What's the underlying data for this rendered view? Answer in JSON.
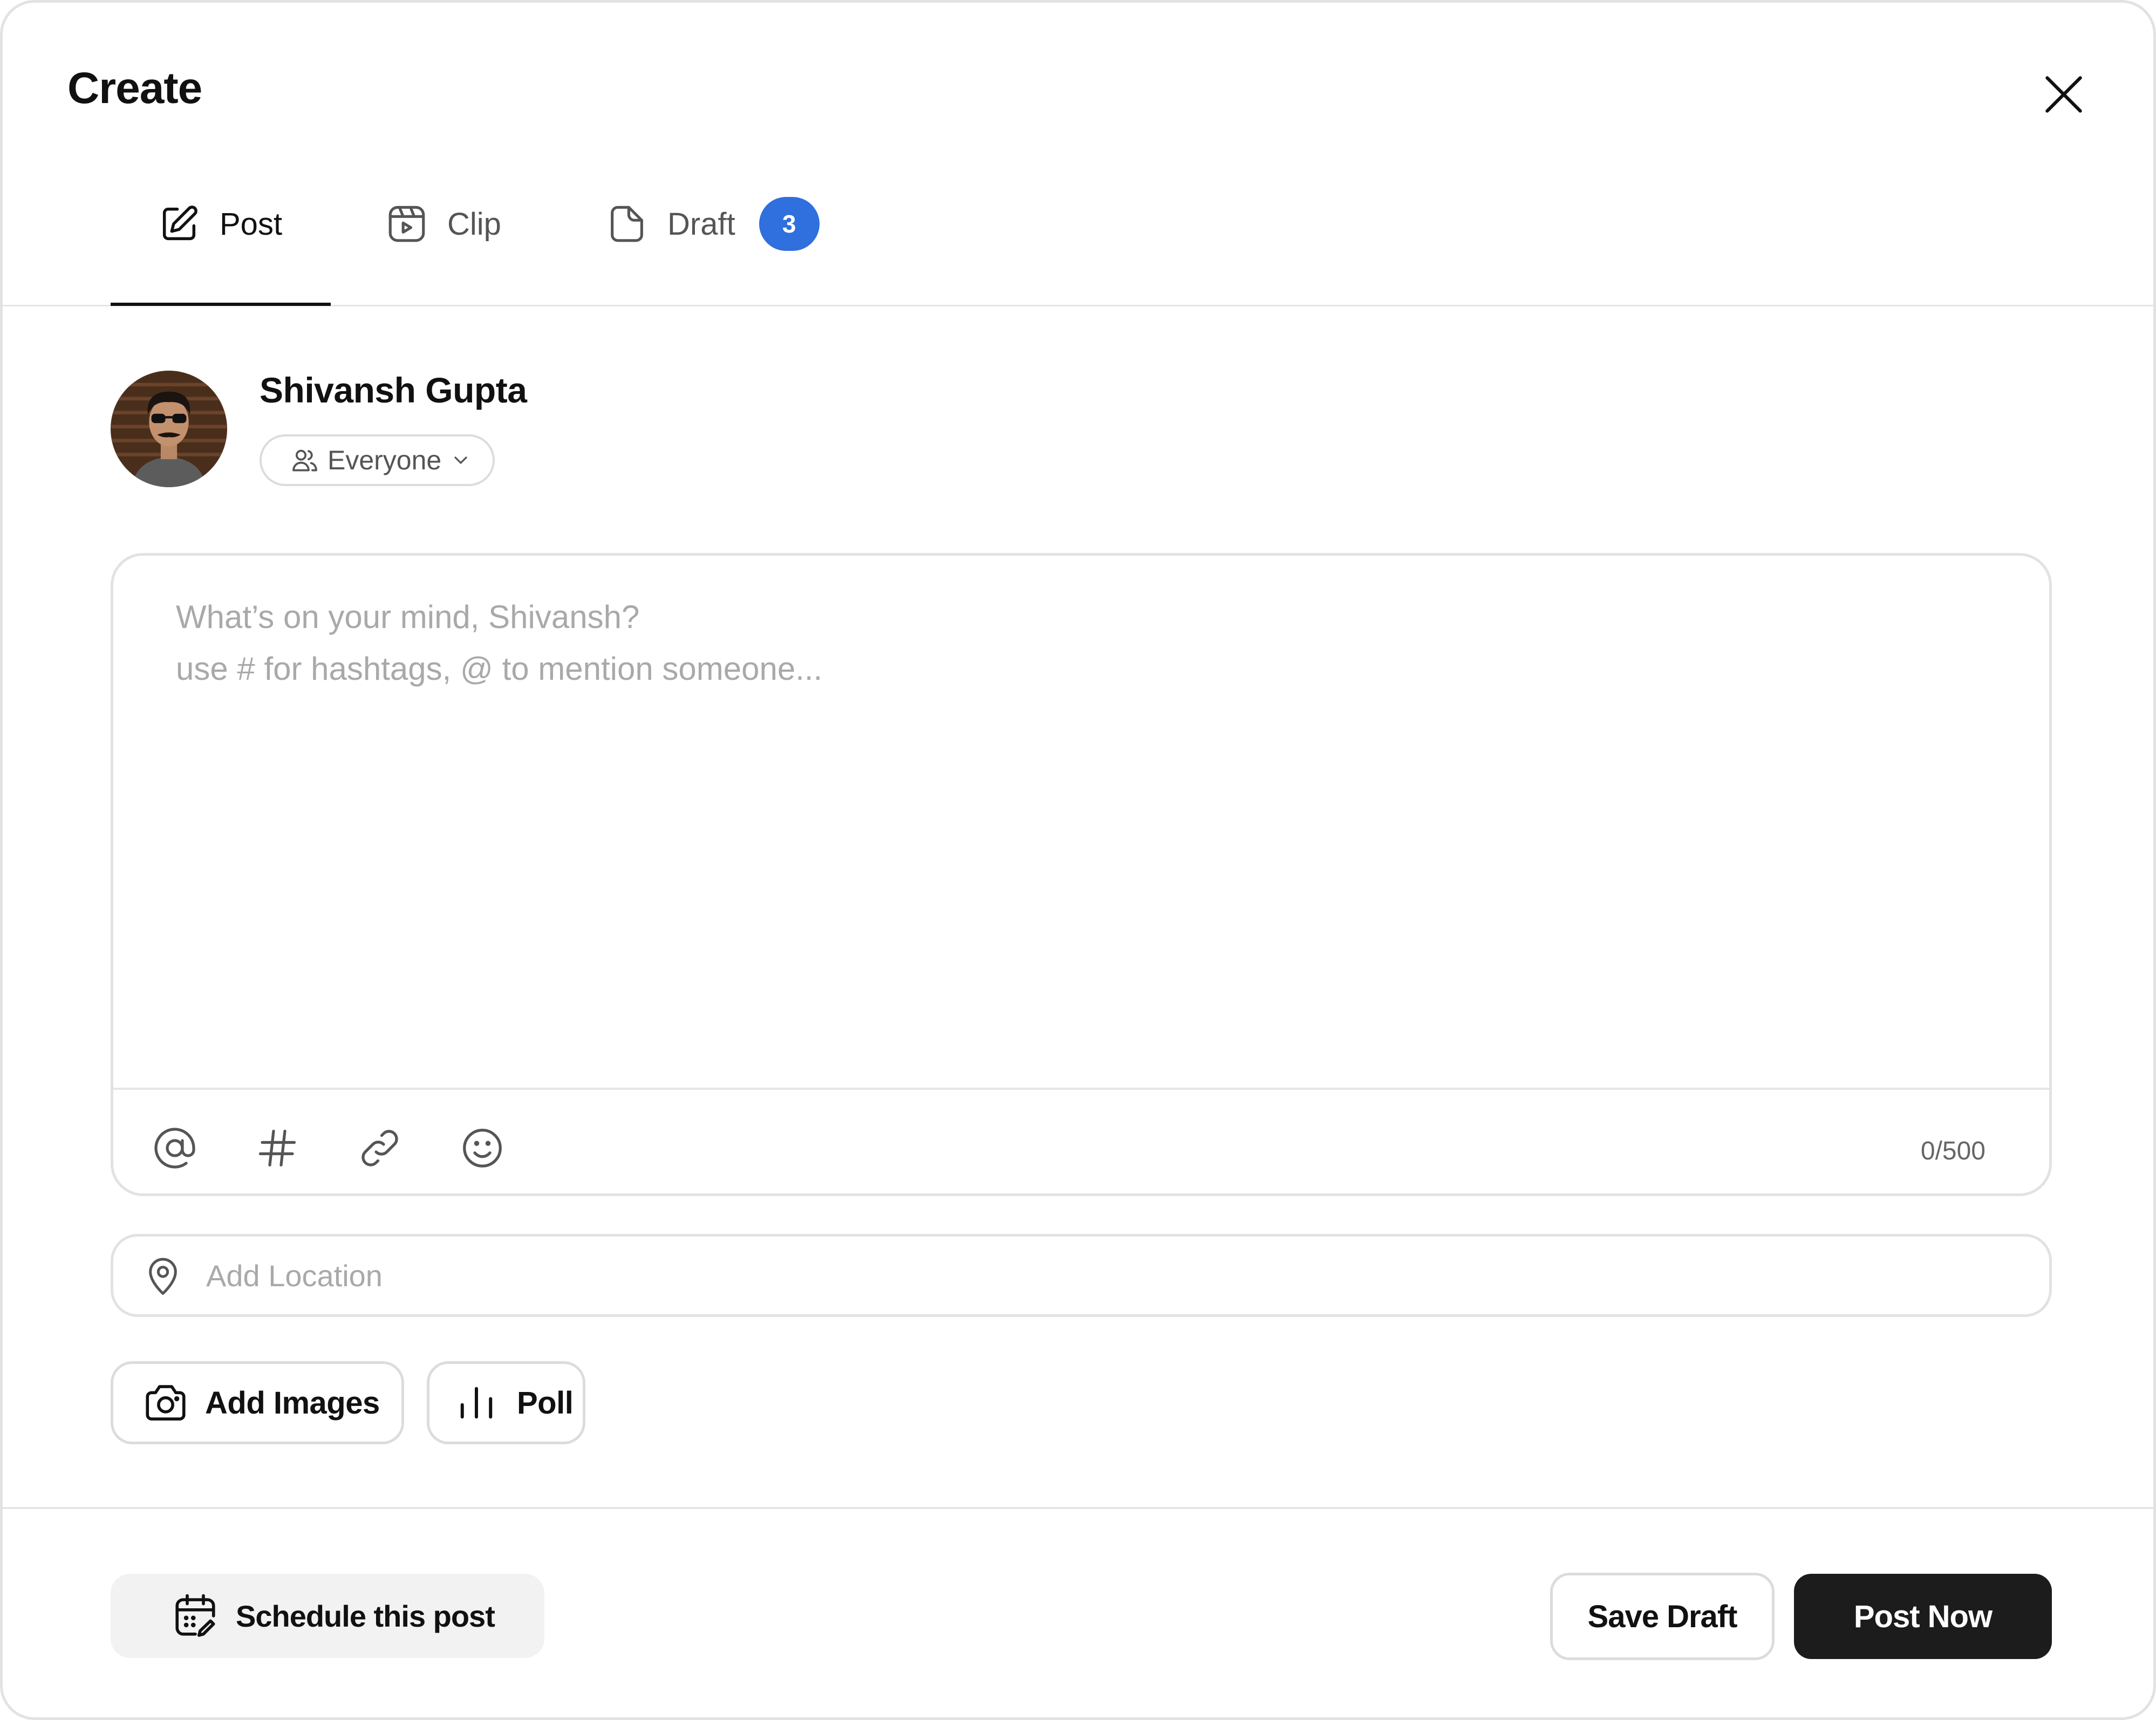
{
  "header": {
    "title": "Create",
    "close_icon": "close-icon"
  },
  "tabs": [
    {
      "label": "Post",
      "icon": "edit-square-icon",
      "active": true
    },
    {
      "label": "Clip",
      "icon": "video-clip-icon",
      "active": false
    },
    {
      "label": "Draft",
      "icon": "document-icon",
      "active": false,
      "badge": "3"
    }
  ],
  "colors": {
    "accent_badge": "#2f6fde",
    "primary_button": "#1c1c1c",
    "border": "#e2e2e2"
  },
  "user": {
    "name": "Shivansh Gupta",
    "audience": {
      "label": "Everyone",
      "icon": "users-icon"
    }
  },
  "composer": {
    "placeholder": "What’s on your mind, Shivansh?\nuse # for hashtags, @ to mention someone...",
    "value": "",
    "char_count": "0/500",
    "tools": [
      "mention-icon",
      "hashtag-icon",
      "link-icon",
      "emoji-icon"
    ]
  },
  "location": {
    "placeholder": "Add Location",
    "value": ""
  },
  "attachments": {
    "add_images_label": "Add Images",
    "poll_label": "Poll"
  },
  "footer": {
    "schedule_label": "Schedule this post",
    "save_draft_label": "Save Draft",
    "post_now_label": "Post Now"
  }
}
